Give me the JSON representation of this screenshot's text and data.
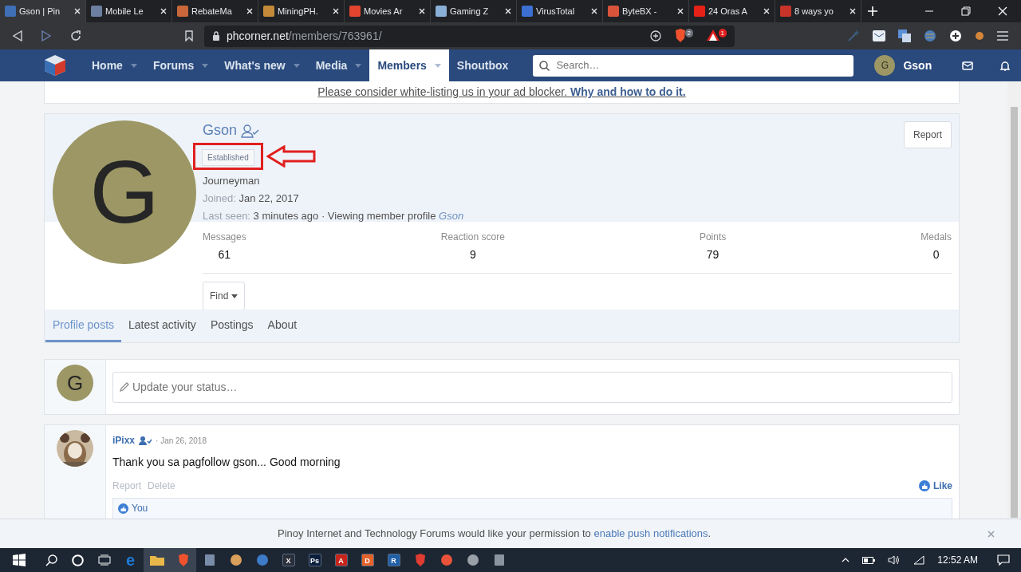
{
  "browser": {
    "tabs": [
      {
        "title": "Gson | Pin",
        "color": "#3f6fb5",
        "selected": true
      },
      {
        "title": "Mobile Le",
        "color": "#6c7fa0",
        "selected": false
      },
      {
        "title": "RebateMa",
        "color": "#c9673a",
        "selected": false
      },
      {
        "title": "MiningPH.",
        "color": "#c48a3a",
        "selected": false
      },
      {
        "title": "Movies Ar",
        "color": "#e2452f",
        "selected": false
      },
      {
        "title": "Gaming Z",
        "color": "#8ab0d8",
        "selected": false
      },
      {
        "title": "VirusTotal",
        "color": "#3b6fd1",
        "selected": false
      },
      {
        "title": "ByteBX -",
        "color": "#d8533a",
        "selected": false
      },
      {
        "title": "24 Oras A",
        "color": "#e62117",
        "selected": false
      },
      {
        "title": "8 ways yo",
        "color": "#c8332a",
        "selected": false
      }
    ],
    "url": {
      "domain": "phcorner.net",
      "path": "/members/763961/"
    },
    "shield_count": "2",
    "alert_count": "1"
  },
  "site_nav": {
    "items": [
      {
        "label": "Home",
        "dropdown": true,
        "selected": false
      },
      {
        "label": "Forums",
        "dropdown": true,
        "selected": false
      },
      {
        "label": "What's new",
        "dropdown": true,
        "selected": false
      },
      {
        "label": "Media",
        "dropdown": true,
        "selected": false
      },
      {
        "label": "Members",
        "dropdown": true,
        "selected": true
      },
      {
        "label": "Shoutbox",
        "dropdown": false,
        "selected": false
      }
    ],
    "search_placeholder": "Search…",
    "user_initial": "G",
    "user_name": "Gson"
  },
  "notice": "Please consider white-listing us in your ad blocker. **Why and how to do it.**",
  "profile": {
    "avatar_initial": "G",
    "name": "Gson",
    "badge": "Established",
    "title": "Journeyman",
    "joined_label": "Joined:",
    "joined": "Jan 22, 2017",
    "last_seen_label": "Last seen:",
    "last_seen": "3 minutes ago · Viewing member profile",
    "last_seen_place": "Gson",
    "report": "Report",
    "stats": [
      {
        "label": "Messages",
        "value": "61"
      },
      {
        "label": "Reaction score",
        "value": "9"
      },
      {
        "label": "Points",
        "value": "79"
      },
      {
        "label": "Medals",
        "value": "0"
      }
    ],
    "find": "Find",
    "tabs": [
      {
        "label": "Profile posts",
        "selected": true
      },
      {
        "label": "Latest activity",
        "selected": false
      },
      {
        "label": "Postings",
        "selected": false
      },
      {
        "label": "About",
        "selected": false
      }
    ]
  },
  "status": {
    "avatar_initial": "G",
    "placeholder": "Update your status…"
  },
  "posts": [
    {
      "author": "iPixx",
      "date": "· Jan 26, 2018",
      "message": "Thank you sa pagfollow gson... Good morning",
      "actions": [
        "Report",
        "Delete"
      ],
      "like": "Like",
      "reactions": "You"
    }
  ],
  "push_bar": {
    "text": "Pinoy Internet and Technology Forums would like your permission to ",
    "link": "enable push notifications",
    "end": "."
  },
  "taskbar": {
    "apps": [
      {
        "kind": "letter",
        "glyph": "e",
        "color": "#1e7ad6",
        "active": false
      },
      {
        "kind": "folder",
        "color": "#e8b84a",
        "active": true
      },
      {
        "kind": "shield",
        "color": "#f0522d",
        "active": true
      },
      {
        "kind": "square",
        "color": "#7a8da8",
        "active": false
      },
      {
        "kind": "dot",
        "color": "#d9a05b",
        "active": false
      },
      {
        "kind": "dot",
        "color": "#3d7cc9",
        "active": false
      },
      {
        "kind": "tile",
        "glyph": "X",
        "color": "#2a2f3a",
        "active": false
      },
      {
        "kind": "tile",
        "glyph": "Ps",
        "color": "#0b1e3b",
        "active": false
      },
      {
        "kind": "tile",
        "glyph": "A",
        "color": "#c8241b",
        "active": false
      },
      {
        "kind": "tile",
        "glyph": "D",
        "color": "#e5622b",
        "active": false
      },
      {
        "kind": "tile",
        "glyph": "R",
        "color": "#2060a8",
        "active": false
      },
      {
        "kind": "shield",
        "color": "#e03c31",
        "active": false
      },
      {
        "kind": "dot",
        "color": "#e8533a",
        "active": false
      },
      {
        "kind": "dot",
        "color": "#9aa0a8",
        "active": false
      },
      {
        "kind": "square",
        "color": "#8a93a0",
        "active": false
      }
    ],
    "time": "12:52 AM"
  }
}
